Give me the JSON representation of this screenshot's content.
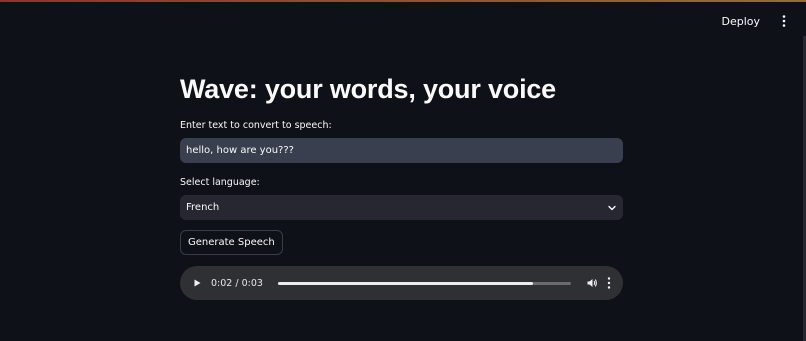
{
  "header": {
    "deploy_label": "Deploy",
    "menu_icon": "vertical-ellipsis-icon"
  },
  "main": {
    "title": "Wave: your words, your voice",
    "text_field": {
      "label": "Enter text to convert to speech:",
      "value": "hello, how are you???"
    },
    "language_select": {
      "label": "Select language:",
      "value": "French",
      "icon": "chevron-down-icon"
    },
    "generate_button_label": "Generate Speech",
    "audio_player": {
      "time_display": "0:02 / 0:03",
      "progress_fraction": 0.87,
      "icons": [
        "play-icon",
        "volume-icon",
        "vertical-ellipsis-icon"
      ]
    }
  },
  "colors": {
    "background": "#0e1117",
    "input_bg": "#393f4f",
    "select_bg": "#262730",
    "audio_bg": "#2f3033",
    "text": "#fafafa"
  }
}
